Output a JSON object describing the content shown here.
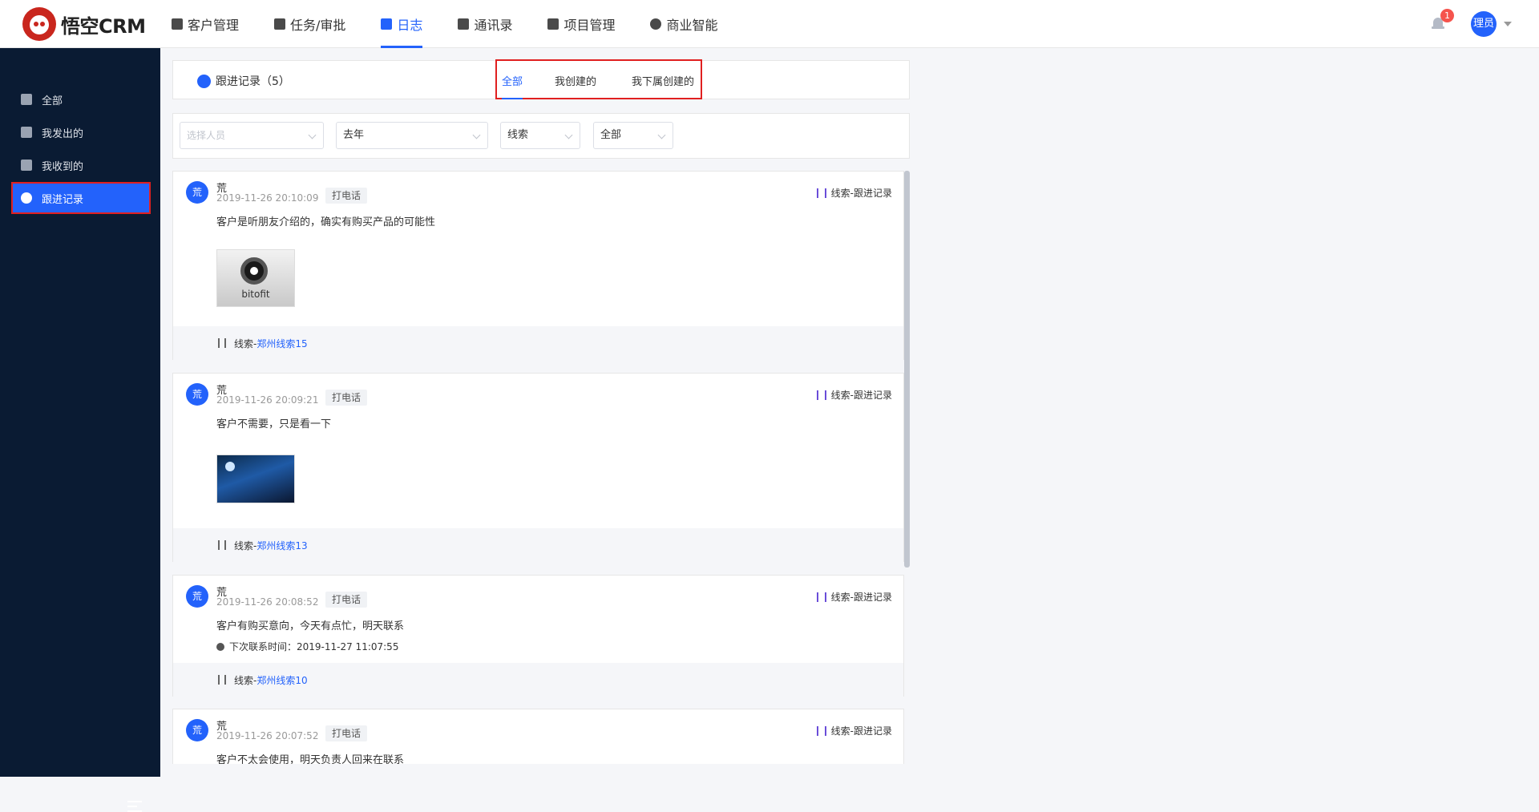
{
  "app": {
    "logo_text": "悟空CRM"
  },
  "nav": [
    {
      "label": "客户管理",
      "active": false
    },
    {
      "label": "任务/审批",
      "active": false
    },
    {
      "label": "日志",
      "active": true
    },
    {
      "label": "通讯录",
      "active": false
    },
    {
      "label": "项目管理",
      "active": false
    },
    {
      "label": "商业智能",
      "active": false
    }
  ],
  "header_right": {
    "notification_count": "1",
    "user_avatar_text": "理员"
  },
  "sidebar": {
    "items": [
      {
        "label": "全部",
        "icon": "grid-icon",
        "active": false
      },
      {
        "label": "我发出的",
        "icon": "send-icon",
        "active": false
      },
      {
        "label": "我收到的",
        "icon": "mail-icon",
        "active": false
      },
      {
        "label": "跟进记录",
        "icon": "chat-icon",
        "active": true
      }
    ]
  },
  "panel": {
    "title": "跟进记录（5）"
  },
  "tabs": [
    {
      "label": "全部",
      "active": true
    },
    {
      "label": "我创建的",
      "active": false
    },
    {
      "label": "我下属创建的",
      "active": false
    }
  ],
  "filters": {
    "person_placeholder": "选择人员",
    "time_value": "去年",
    "type_value": "线索",
    "scope_value": "全部"
  },
  "records": [
    {
      "avatar": "荒",
      "name": "荒",
      "time": "2019-11-26 20:10:09",
      "tag": "打电话",
      "origin": "线索-跟进记录",
      "content": "客户是听朋友介绍的，确实有购买产品的可能性",
      "image_caption": "bitofit",
      "footer_prefix": "线索-",
      "footer_link": "郑州线索15"
    },
    {
      "avatar": "荒",
      "name": "荒",
      "time": "2019-11-26 20:09:21",
      "tag": "打电话",
      "origin": "线索-跟进记录",
      "content": "客户不需要，只是看一下",
      "footer_prefix": "线索-",
      "footer_link": "郑州线索13"
    },
    {
      "avatar": "荒",
      "name": "荒",
      "time": "2019-11-26 20:08:52",
      "tag": "打电话",
      "origin": "线索-跟进记录",
      "content": "客户有购买意向，今天有点忙，明天联系",
      "next_contact": "下次联系时间：2019-11-27 11:07:55",
      "footer_prefix": "线索-",
      "footer_link": "郑州线索10"
    },
    {
      "avatar": "荒",
      "name": "荒",
      "time": "2019-11-26 20:07:52",
      "tag": "打电话",
      "origin": "线索-跟进记录",
      "content": "客户不太会使用，明天负责人回来在联系"
    }
  ]
}
